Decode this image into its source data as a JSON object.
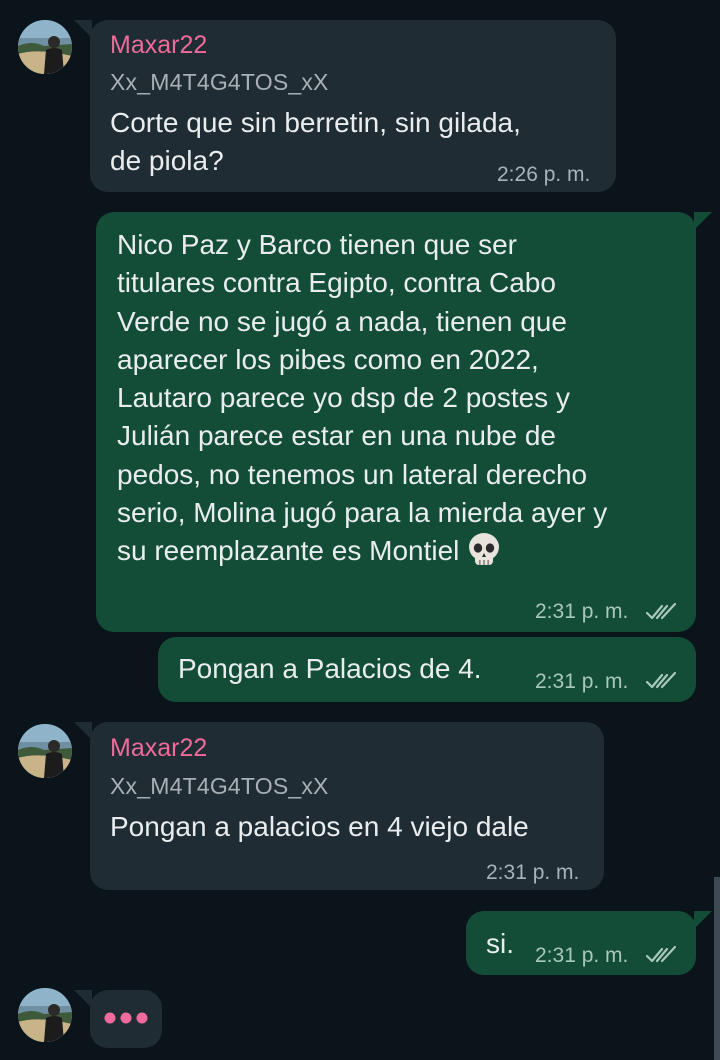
{
  "messages": [
    {
      "direction": "incoming",
      "sender": "Maxar22",
      "handle": "Xx_M4T4G4TOS_xX",
      "lines": [
        "Corte que sin berretin, sin gilada,",
        "de piola?"
      ],
      "time": "2:26 p. m."
    },
    {
      "direction": "outgoing",
      "lines": [
        "Nico Paz y Barco tienen que ser",
        "titulares contra Egipto, contra Cabo",
        "Verde no se jugó a nada, tienen que",
        "aparecer los pibes como en 2022,",
        "Lautaro parece yo dsp de 2 postes y",
        "Julián parece estar en una nube de",
        "pedos, no tenemos un lateral derecho",
        "serio, Molina jugó para la mierda ayer y",
        "su reemplazante es Montiel"
      ],
      "emoji": "skull-emoji",
      "time": "2:31 p. m.",
      "status": "read"
    },
    {
      "direction": "outgoing",
      "text": "Pongan a Palacios de 4.",
      "time": "2:31 p. m.",
      "status": "read"
    },
    {
      "direction": "incoming",
      "sender": "Maxar22",
      "handle": "Xx_M4T4G4TOS_xX",
      "text": "Pongan a palacios en 4 viejo dale",
      "time": "2:31 p. m."
    },
    {
      "direction": "outgoing",
      "text": "si.",
      "time": "2:31 p. m.",
      "status": "read"
    }
  ],
  "typing_indicator": "typing-dots",
  "colors": {
    "background": "#0b141a",
    "incoming_bubble": "#202c33",
    "outgoing_bubble": "#134d37",
    "sender_name": "#ef6b9b",
    "read_ticks": "#a9c8bc"
  }
}
